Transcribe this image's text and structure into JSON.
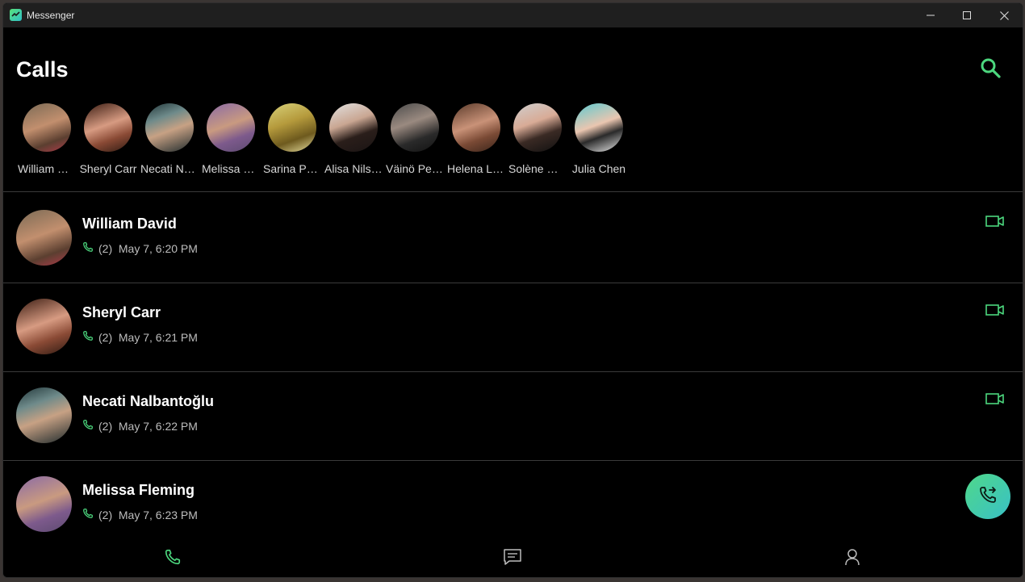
{
  "window": {
    "title": "Messenger"
  },
  "header": {
    "title": "Calls"
  },
  "favorites": [
    {
      "name": "William David",
      "avatar": "linear-gradient(160deg,#7a6a55 0%,#c28f6e 45%,#5b3f30 75%,#b13a4a 100%)"
    },
    {
      "name": "Sheryl Carr",
      "avatar": "linear-gradient(160deg,#3a1c12 0%,#d79b82 45%,#8a4a35 70%,#2e1a12 100%)"
    },
    {
      "name": "Necati Nalbantoğlu",
      "avatar": "linear-gradient(160deg,#203538 0%,#6e8a8a 30%,#c7a184 55%,#1e2a2c 100%)"
    },
    {
      "name": "Melissa Fleming",
      "avatar": "linear-gradient(160deg,#8a6aa6 0%,#c99a80 45%,#7d5a8c 70%,#5c4a70 100%)"
    },
    {
      "name": "Sarina Peltonen",
      "avatar": "linear-gradient(160deg,#d8d27a 0%,#b59a3c 40%,#6e5a1e 70%,#e8e0a0 100%)"
    },
    {
      "name": "Alisa Nilsen",
      "avatar": "linear-gradient(160deg,#e2e2e2 0%,#c9a692 40%,#2a1e1a 65%,#1a1414 100%)"
    },
    {
      "name": "Väinö Pesonen",
      "avatar": "linear-gradient(160deg,#4a4a4a 0%,#9a8a80 40%,#2a2a2a 70%,#121212 100%)"
    },
    {
      "name": "Helena Lehtonen",
      "avatar": "linear-gradient(160deg,#5a3a2a 0%,#c99278 45%,#7a4a35 70%,#3a241a 100%)"
    },
    {
      "name": "Solène Moreau",
      "avatar": "linear-gradient(160deg,#cfcfcf 0%,#d8ab96 40%,#3a2a24 65%,#101010 100%)"
    },
    {
      "name": "Julia Chen",
      "avatar": "linear-gradient(160deg,#5ccad0 0%,#eac6b0 45%,#2a2a2a 65%,#eaeaea 100%)"
    }
  ],
  "calls": [
    {
      "name": "William David",
      "detail": "(2)  May 7, 6:20 PM",
      "avatar": "linear-gradient(160deg,#7a6a55 0%,#c28f6e 45%,#5b3f30 75%,#b13a4a 100%)"
    },
    {
      "name": "Sheryl Carr",
      "detail": "(2)  May 7, 6:21 PM",
      "avatar": "linear-gradient(160deg,#3a1c12 0%,#d79b82 45%,#8a4a35 70%,#2e1a12 100%)"
    },
    {
      "name": "Necati Nalbantoğlu",
      "detail": "(2)  May 7, 6:22 PM",
      "avatar": "linear-gradient(160deg,#203538 0%,#6e8a8a 30%,#c7a184 55%,#1e2a2c 100%)"
    },
    {
      "name": "Melissa Fleming",
      "detail": "(2)  May 7, 6:23 PM",
      "avatar": "linear-gradient(160deg,#8a6aa6 0%,#c99a80 45%,#7d5a8c 70%,#5c4a70 100%)"
    }
  ],
  "colors": {
    "accent": "#4cd77e",
    "background": "#000000",
    "titlebar": "#1f1f1f"
  },
  "icons": {
    "search": "search-icon",
    "video": "video-camera-icon",
    "phone": "phone-icon",
    "new_call": "phone-forward-icon",
    "nav_calls": "phone-icon",
    "nav_chats": "chat-icon",
    "nav_contacts": "person-icon"
  }
}
